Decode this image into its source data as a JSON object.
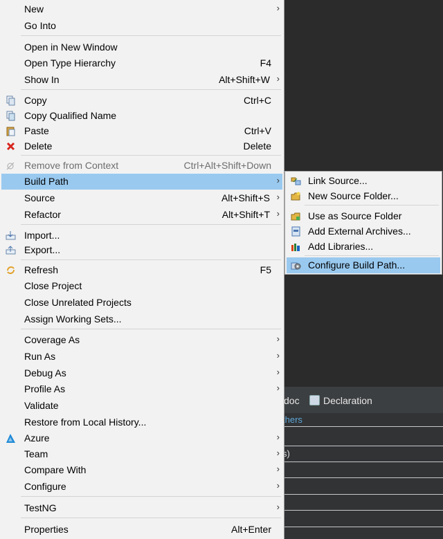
{
  "menu": {
    "items": [
      {
        "label": "New",
        "shortcut": "",
        "arrow": true
      },
      {
        "label": "Go Into",
        "shortcut": "",
        "arrow": false
      },
      {
        "label": "Open in New Window",
        "shortcut": "",
        "arrow": false
      },
      {
        "label": "Open Type Hierarchy",
        "shortcut": "F4",
        "arrow": false
      },
      {
        "label": "Show In",
        "shortcut": "Alt+Shift+W",
        "arrow": true
      },
      {
        "label": "Copy",
        "shortcut": "Ctrl+C",
        "arrow": false,
        "icon": "copy-icon"
      },
      {
        "label": "Copy Qualified Name",
        "shortcut": "",
        "arrow": false,
        "icon": "copy-qualified-name-icon"
      },
      {
        "label": "Paste",
        "shortcut": "Ctrl+V",
        "arrow": false,
        "icon": "paste-icon"
      },
      {
        "label": "Delete",
        "shortcut": "Delete",
        "arrow": false,
        "icon": "delete-icon"
      },
      {
        "label": "Remove from Context",
        "shortcut": "Ctrl+Alt+Shift+Down",
        "arrow": false,
        "disabled": true,
        "icon": "remove-from-context-icon"
      },
      {
        "label": "Build Path",
        "shortcut": "",
        "arrow": true,
        "highlighted": true
      },
      {
        "label": "Source",
        "shortcut": "Alt+Shift+S",
        "arrow": true
      },
      {
        "label": "Refactor",
        "shortcut": "Alt+Shift+T",
        "arrow": true
      },
      {
        "label": "Import...",
        "shortcut": "",
        "arrow": false,
        "icon": "import-icon"
      },
      {
        "label": "Export...",
        "shortcut": "",
        "arrow": false,
        "icon": "export-icon"
      },
      {
        "label": "Refresh",
        "shortcut": "F5",
        "arrow": false,
        "icon": "refresh-icon"
      },
      {
        "label": "Close Project",
        "shortcut": "",
        "arrow": false
      },
      {
        "label": "Close Unrelated Projects",
        "shortcut": "",
        "arrow": false
      },
      {
        "label": "Assign Working Sets...",
        "shortcut": "",
        "arrow": false
      },
      {
        "label": "Coverage As",
        "shortcut": "",
        "arrow": true
      },
      {
        "label": "Run As",
        "shortcut": "",
        "arrow": true
      },
      {
        "label": "Debug As",
        "shortcut": "",
        "arrow": true
      },
      {
        "label": "Profile As",
        "shortcut": "",
        "arrow": true
      },
      {
        "label": "Validate",
        "shortcut": "",
        "arrow": false
      },
      {
        "label": "Restore from Local History...",
        "shortcut": "",
        "arrow": false
      },
      {
        "label": "Azure",
        "shortcut": "",
        "arrow": true,
        "icon": "azure-icon"
      },
      {
        "label": "Team",
        "shortcut": "",
        "arrow": true
      },
      {
        "label": "Compare With",
        "shortcut": "",
        "arrow": true
      },
      {
        "label": "Configure",
        "shortcut": "",
        "arrow": true
      },
      {
        "label": "TestNG",
        "shortcut": "",
        "arrow": true
      },
      {
        "label": "Properties",
        "shortcut": "Alt+Enter",
        "arrow": false
      }
    ]
  },
  "submenu": {
    "items": [
      {
        "label": "Link Source...",
        "icon": "link-source-icon"
      },
      {
        "label": "New Source Folder...",
        "icon": "new-source-folder-icon"
      },
      {
        "label": "Use as Source Folder",
        "icon": "use-as-source-folder-icon"
      },
      {
        "label": "Add External Archives...",
        "icon": "add-external-archives-icon"
      },
      {
        "label": "Add Libraries...",
        "icon": "add-libraries-icon"
      },
      {
        "label": "Configure Build Path...",
        "icon": "configure-build-path-icon",
        "highlighted": true
      }
    ]
  },
  "panel": {
    "tab_javadoc": "doc",
    "tab_declaration": "Declaration",
    "link_text": "thers",
    "row_text": "s)"
  },
  "arrow_glyph": "›"
}
